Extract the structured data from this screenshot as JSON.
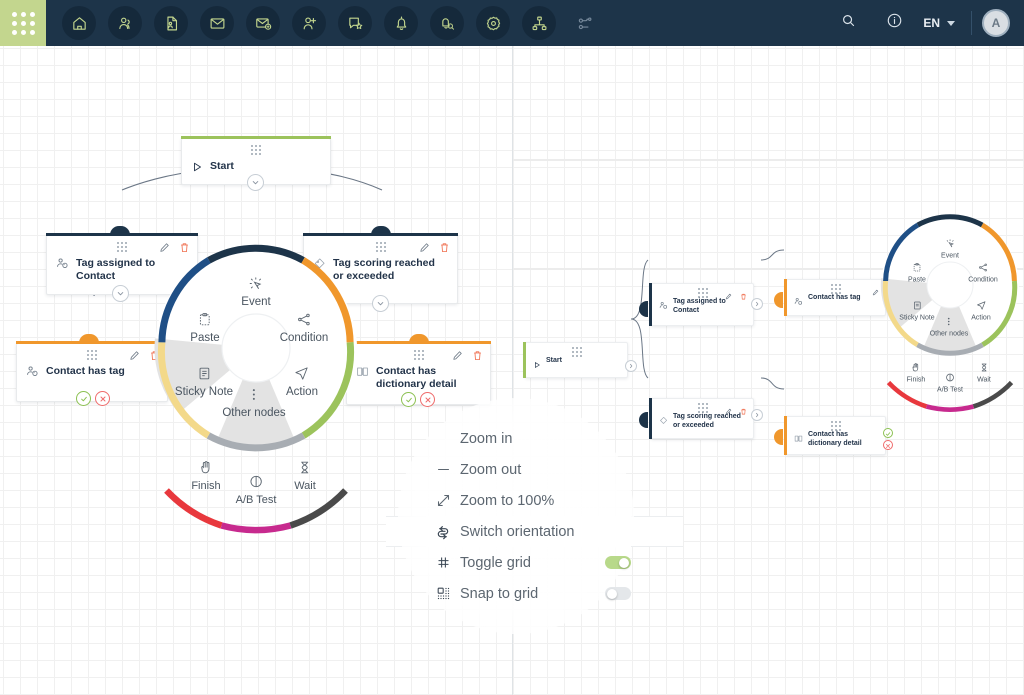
{
  "topbar": {
    "launcher": "app-grid",
    "nav_items": [
      {
        "name": "home-icon",
        "label": "Home"
      },
      {
        "name": "contacts-icon",
        "label": "Contacts"
      },
      {
        "name": "document-contact-icon",
        "label": "Contact Files"
      },
      {
        "name": "mail-icon",
        "label": "Email"
      },
      {
        "name": "mail-settings-icon",
        "label": "Email Settings"
      },
      {
        "name": "add-contact-icon",
        "label": "Add Contact"
      },
      {
        "name": "sms-icon",
        "label": "Messages"
      },
      {
        "name": "bell-icon",
        "label": "Notifications"
      },
      {
        "name": "bell-search-icon",
        "label": "Notification Search"
      },
      {
        "name": "gear-icon",
        "label": "Settings"
      },
      {
        "name": "sitemap-icon",
        "label": "Structure"
      },
      {
        "name": "workflow-icon",
        "label": "Workflows"
      }
    ],
    "search_icon": "search-icon",
    "info_icon": "info-icon",
    "language": "EN",
    "avatar_initial": "A"
  },
  "left_panel": {
    "nodes": [
      {
        "id": "start",
        "label": "Start",
        "icon": "play-icon",
        "accent": "green"
      },
      {
        "id": "tag-assigned",
        "label": "Tag assigned to Contact",
        "icon": "tag-person-icon",
        "accent": "navy"
      },
      {
        "id": "tag-scoring",
        "label": "Tag scoring reached or exceeded",
        "icon": "tag-score-icon",
        "accent": "navy"
      },
      {
        "id": "contact-has-tag",
        "label": "Contact has tag",
        "icon": "tag-person-icon",
        "accent": "orange"
      },
      {
        "id": "contact-dictionary",
        "label": "Contact has dictionary detail",
        "icon": "book-icon",
        "accent": "orange"
      }
    ],
    "node_actions": {
      "edit": "pencil-icon",
      "delete": "trash-icon"
    },
    "branch_yes": "check-icon",
    "branch_no": "cross-icon"
  },
  "right_panel": {
    "nodes": [
      {
        "id": "start",
        "label": "Start",
        "icon": "play-icon",
        "accent": "green"
      },
      {
        "id": "tag-assigned",
        "label": "Tag assigned to Contact",
        "icon": "tag-person-icon",
        "accent": "navy"
      },
      {
        "id": "tag-scoring",
        "label": "Tag scoring reached or exceeded",
        "icon": "tag-score-icon",
        "accent": "navy"
      },
      {
        "id": "contact-has-tag",
        "label": "Contact has tag",
        "icon": "tag-person-icon",
        "accent": "orange"
      },
      {
        "id": "contact-dictionary",
        "label": "Contact has dictionary detail",
        "icon": "book-icon",
        "accent": "orange"
      }
    ]
  },
  "radial_menu": {
    "inner_items": [
      {
        "label": "Event",
        "icon": "event-icon",
        "color": "#1d3449"
      },
      {
        "label": "Condition",
        "icon": "condition-icon",
        "color": "#f0972c"
      },
      {
        "label": "Action",
        "icon": "action-icon",
        "color": "#9cc35c"
      },
      {
        "label": "Other nodes",
        "icon": "dots-icon",
        "color": "#a8adb3"
      },
      {
        "label": "Sticky Note",
        "icon": "note-icon",
        "color": "#f3d98a"
      },
      {
        "label": "Paste",
        "icon": "paste-icon",
        "color": "#1f4f86"
      }
    ],
    "outer_items": [
      {
        "label": "Finish",
        "icon": "hand-icon",
        "color": "#e8383d"
      },
      {
        "label": "A/B Test",
        "icon": "abtest-icon",
        "color": "#c72a8e"
      },
      {
        "label": "Wait",
        "icon": "hourglass-icon",
        "color": "#4a4a4a"
      }
    ]
  },
  "context_menu": {
    "items": [
      {
        "label": "Zoom in",
        "icon": "plus-icon",
        "type": "action",
        "highlighted": false
      },
      {
        "label": "Zoom out",
        "icon": "minus-icon",
        "type": "action",
        "highlighted": false
      },
      {
        "label": "Zoom to 100%",
        "icon": "expand-icon",
        "type": "action",
        "highlighted": false
      },
      {
        "label": "Switch orientation",
        "icon": "switch-icon",
        "type": "action",
        "highlighted": true
      },
      {
        "label": "Toggle grid",
        "icon": "grid-icon",
        "type": "toggle",
        "value": "on",
        "highlighted": false
      },
      {
        "label": "Snap to grid",
        "icon": "snap-grid-icon",
        "type": "toggle",
        "value": "off",
        "highlighted": false
      }
    ]
  },
  "colors": {
    "topbar_bg": "#1d3449",
    "launcher_bg": "#c3d68e",
    "accent_green": "#9cc35c",
    "accent_orange": "#f0972c",
    "accent_navy": "#1d3449",
    "toggle_on": "#b8d98a"
  }
}
